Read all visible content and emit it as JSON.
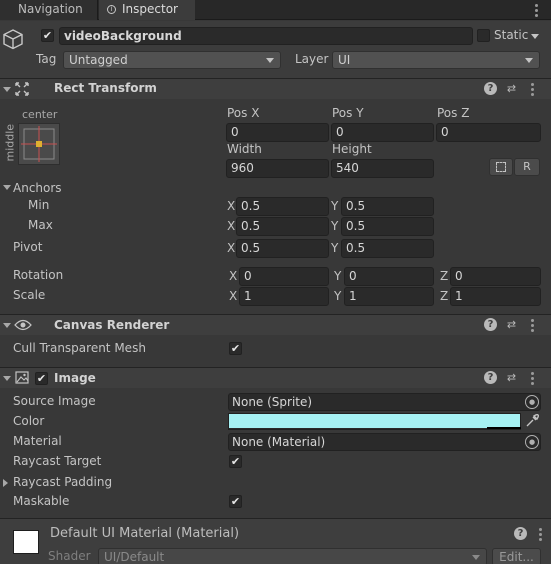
{
  "tabs": [
    {
      "label": "Navigation"
    },
    {
      "label": "Inspector"
    }
  ],
  "object": {
    "name": "videoBackground",
    "active": true,
    "static_label": "Static",
    "static_checked": false,
    "tag_label": "Tag",
    "tag_value": "Untagged",
    "layer_label": "Layer",
    "layer_value": "UI"
  },
  "rect_transform": {
    "title": "Rect Transform",
    "anchor_preset_h": "center",
    "anchor_preset_v": "middle",
    "pos_x_label": "Pos X",
    "pos_x": "0",
    "pos_y_label": "Pos Y",
    "pos_y": "0",
    "pos_z_label": "Pos Z",
    "pos_z": "0",
    "width_label": "Width",
    "width": "960",
    "height_label": "Height",
    "height": "540",
    "r_button": "R",
    "anchors_label": "Anchors",
    "min_label": "Min",
    "min_x": "0.5",
    "min_y": "0.5",
    "max_label": "Max",
    "max_x": "0.5",
    "max_y": "0.5",
    "pivot_label": "Pivot",
    "pivot_x": "0.5",
    "pivot_y": "0.5",
    "rotation_label": "Rotation",
    "rot_x": "0",
    "rot_y": "0",
    "rot_z": "0",
    "scale_label": "Scale",
    "scale_x": "1",
    "scale_y": "1",
    "scale_z": "1",
    "x": "X",
    "y": "Y",
    "z": "Z"
  },
  "canvas_renderer": {
    "title": "Canvas Renderer",
    "cull_label": "Cull Transparent Mesh",
    "cull_checked": true
  },
  "image": {
    "title": "Image",
    "enabled": true,
    "source_label": "Source Image",
    "source_value": "None (Sprite)",
    "color_label": "Color",
    "color_value": "#a6f1f3",
    "material_label": "Material",
    "material_value": "None (Material)",
    "raycast_target_label": "Raycast Target",
    "raycast_target_checked": true,
    "raycast_padding_label": "Raycast Padding",
    "maskable_label": "Maskable",
    "maskable_checked": true
  },
  "material_footer": {
    "title": "Default UI Material (Material)",
    "shader_label": "Shader",
    "shader_value": "UI/Default",
    "edit_button": "Edit..."
  },
  "icons": {
    "help": "help-icon",
    "preset": "preset-icon",
    "menu": "context-menu-icon"
  }
}
